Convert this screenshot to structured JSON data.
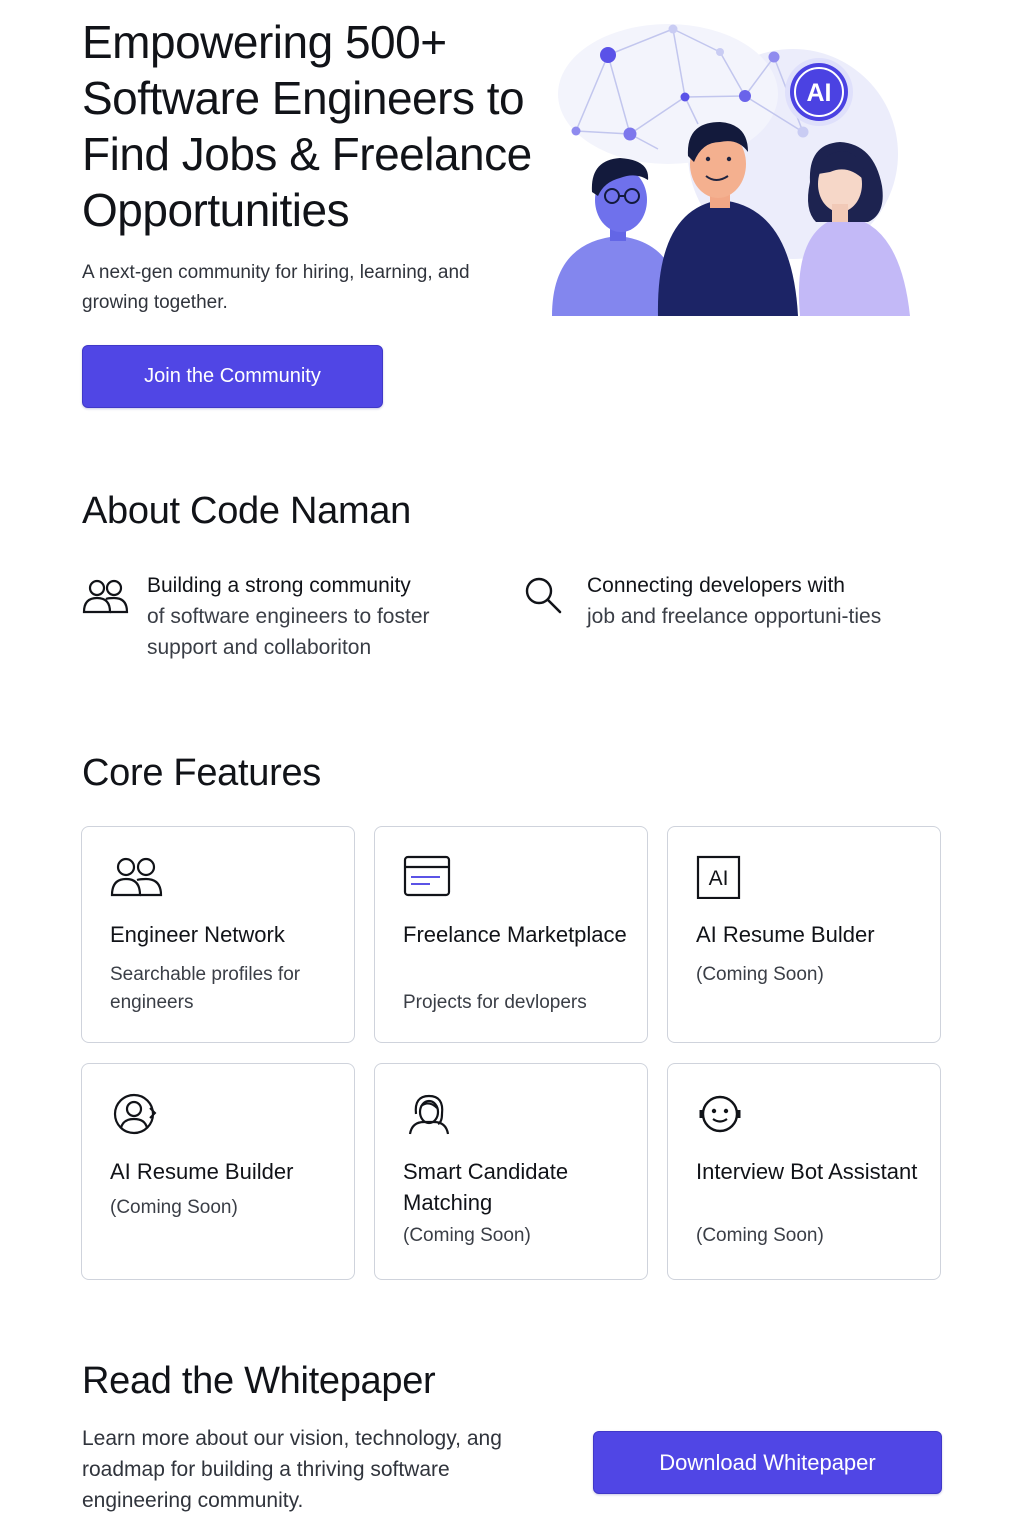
{
  "hero": {
    "title": "Empowering 500+ Software Engineers to Find Jobs & Freelance Opportunities",
    "subtitle": "A next-gen community for hiring, learning, and growing together.",
    "cta_label": "Join the Community",
    "illustration_badge": "AI"
  },
  "about": {
    "title": "About Code Naman",
    "items": [
      {
        "icon": "people-icon",
        "lead": "Building a strong community",
        "rest": "of software engineers to foster support and collaboriton"
      },
      {
        "icon": "search-icon",
        "lead": "Connecting developers with",
        "rest": "job and freelance opportuni-ties"
      }
    ]
  },
  "features": {
    "title": "Core Features",
    "cards": [
      {
        "icon": "people-icon",
        "title": "Engineer Network",
        "desc": "Searchable profiles for engineers"
      },
      {
        "icon": "browser-window-icon",
        "title": "Freelance Marketplace",
        "desc": "Projects for devlopers"
      },
      {
        "icon": "ai-box-icon",
        "icon_text": "AI",
        "title": "AI Resume Bulder",
        "desc": "(Coming Soon)"
      },
      {
        "icon": "user-circle-icon",
        "title": "AI Resume Builder",
        "desc": "(Coming Soon)"
      },
      {
        "icon": "person-outline-icon",
        "title": "Smart Candidate Matching",
        "desc": "(Coming Soon)"
      },
      {
        "icon": "bot-face-icon",
        "title": "Interview Bot Assistant",
        "desc": "(Coming Soon)"
      }
    ]
  },
  "whitepaper": {
    "title": "Read the Whitepaper",
    "text": "Learn more about our vision, technology, ang roadmap for building a thriving software engineering community.",
    "cta_label": "Download Whitepaper"
  },
  "colors": {
    "accent": "#5046e5",
    "text": "#111318",
    "muted": "#3a3e46",
    "border": "#cfd3dc"
  }
}
